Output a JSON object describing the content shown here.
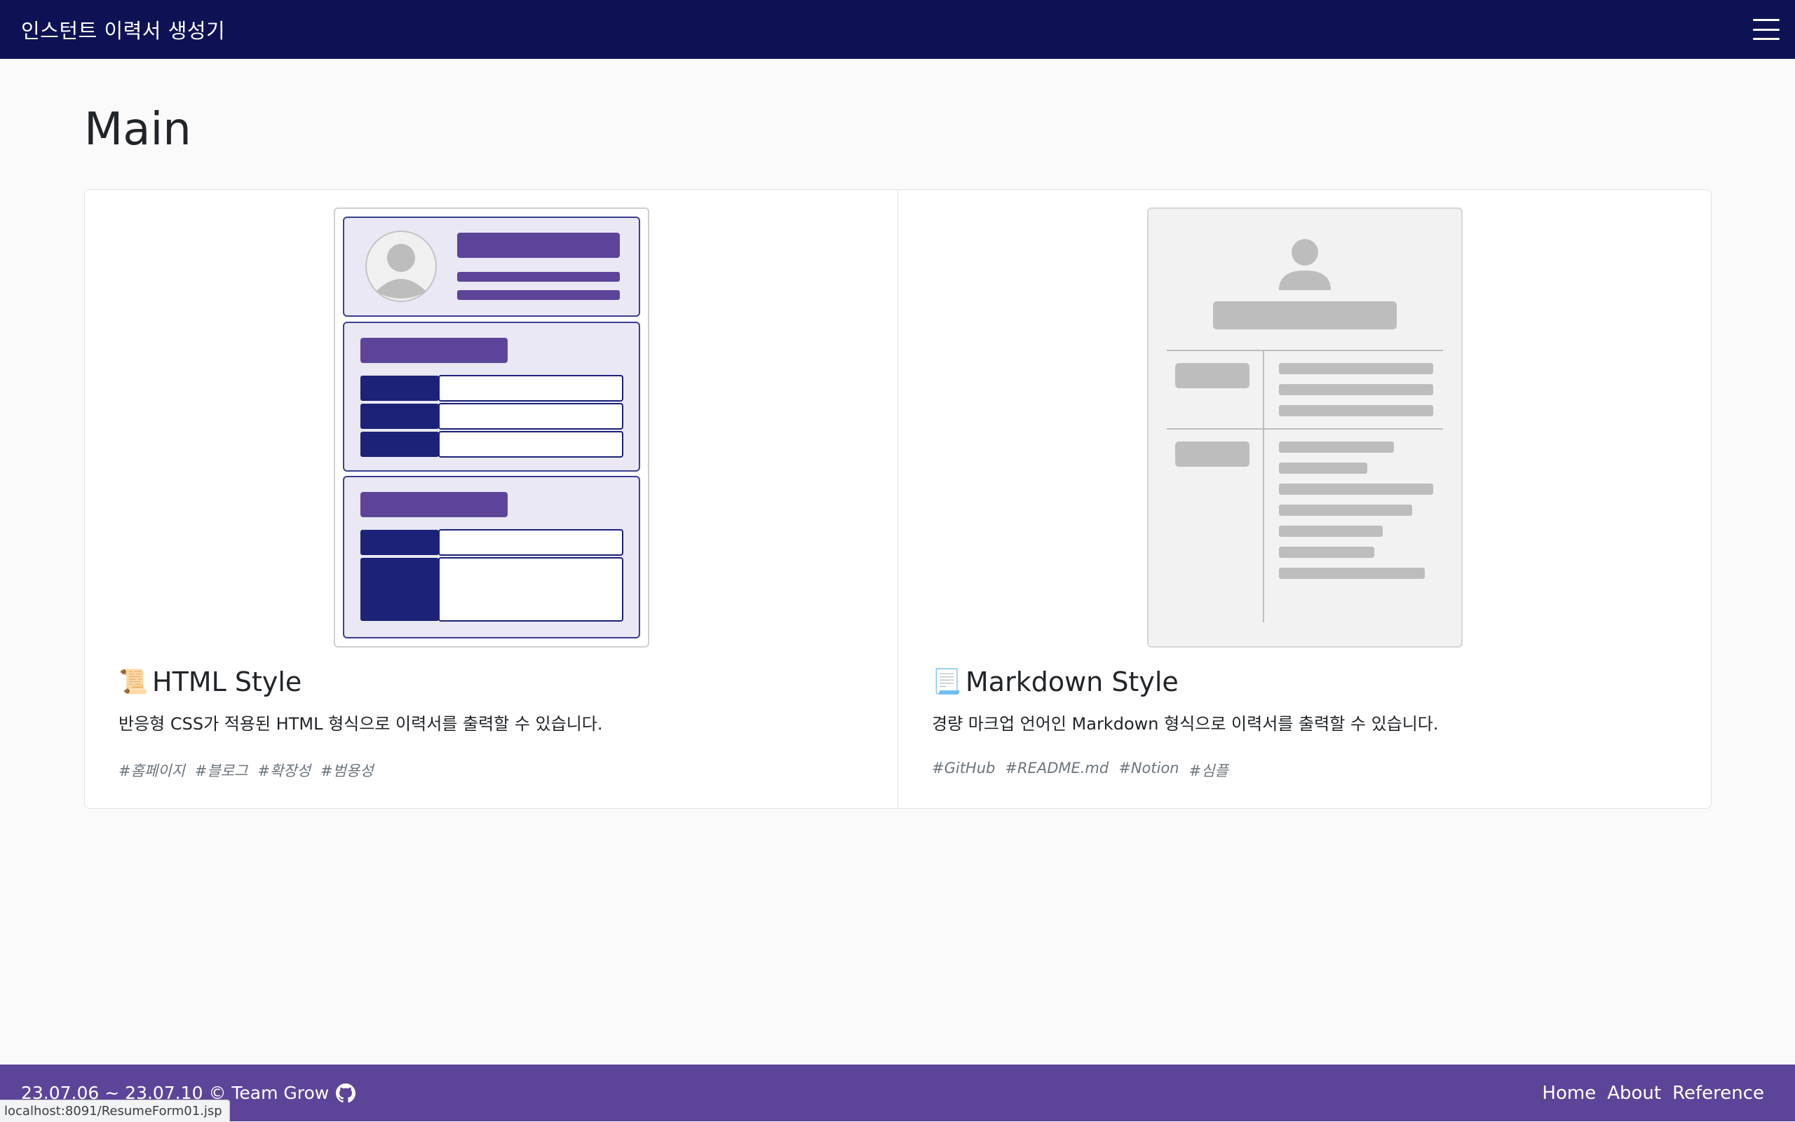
{
  "navbar": {
    "brand": "인스턴트 이력서 생성기",
    "menu_icon": "hamburger-menu-icon"
  },
  "main": {
    "title": "Main",
    "cards": [
      {
        "icon": "scroll-icon",
        "emoji": "📜",
        "title": "HTML Style",
        "description": "반응형 CSS가 적용된 HTML 형식으로 이력서를 출력할 수 있습니다.",
        "tags": [
          "#홈페이지",
          "#블로그",
          "#확장성",
          "#범용성"
        ]
      },
      {
        "icon": "page-icon",
        "emoji": "📃",
        "title": "Markdown Style",
        "description": "경량 마크업 언어인 Markdown 형식으로 이력서를 출력할 수 있습니다.",
        "tags": [
          "#GitHub",
          "#README.md",
          "#Notion",
          "#심플"
        ]
      }
    ]
  },
  "footer": {
    "copyright": "23.07.06 ~ 23.07.10 © Team Grow",
    "github_icon": "github-icon",
    "links": [
      "Home",
      "About",
      "Reference"
    ]
  },
  "status_bar": {
    "url": "localhost:8091/ResumeForm01.jsp"
  },
  "colors": {
    "navbar": "#0e1255",
    "footer": "#5c4599",
    "accent_purple": "#5c4599",
    "accent_navy": "#1b2278"
  }
}
